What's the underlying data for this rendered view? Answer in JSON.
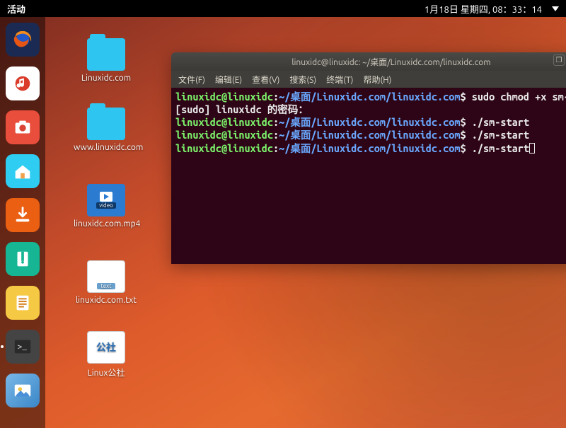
{
  "topbar": {
    "activities": "活动",
    "datetime": "1月18日 星期四, 08：33：14"
  },
  "dock": [
    {
      "name": "firefox",
      "label": "Firefox"
    },
    {
      "name": "music",
      "label": "Rhythmbox"
    },
    {
      "name": "camera",
      "label": "Cheese"
    },
    {
      "name": "files",
      "label": "Files"
    },
    {
      "name": "downloads",
      "label": "Downloads"
    },
    {
      "name": "archive",
      "label": "Archive Manager"
    },
    {
      "name": "notes",
      "label": "Text Editor"
    },
    {
      "name": "terminal",
      "label": "Terminal"
    },
    {
      "name": "photos",
      "label": "Image Viewer"
    }
  ],
  "desktop_icons": [
    {
      "id": "folder1",
      "label": "Linuxidc.com",
      "type": "folder"
    },
    {
      "id": "folder2",
      "label": "www.linuxidc.com",
      "type": "folder"
    },
    {
      "id": "video1",
      "label": "linuxidc.com.mp4",
      "type": "video",
      "badge": "video"
    },
    {
      "id": "txt1",
      "label": "linuxidc.com.txt",
      "type": "txt",
      "badge": "text"
    },
    {
      "id": "img1",
      "label": "Linux公社",
      "type": "img",
      "innertext": "公社"
    }
  ],
  "terminal": {
    "title": "linuxidc@linuxidc: ~/桌面/Linuxidc.com/linuxidc.com",
    "menu": [
      "文件(F)",
      "编辑(E)",
      "查看(V)",
      "搜索(S)",
      "终端(T)",
      "帮助(H)"
    ],
    "ctrls": {
      "min": "–",
      "max": "□",
      "close": "×"
    },
    "prompt_user": "linuxidc@linuxidc",
    "prompt_sep": ":",
    "prompt_path": "~/桌面/Linuxidc.com/linuxidc.com",
    "prompt_end": "$ ",
    "lines": [
      {
        "cmd": "sudo chmod +x sm-"
      },
      {
        "raw": "[sudo] linuxidc 的密码："
      },
      {
        "cmd": "./sm-start"
      },
      {
        "cmd": "./sm-start"
      },
      {
        "cmd": "./sm-start",
        "cursor": true
      }
    ]
  }
}
